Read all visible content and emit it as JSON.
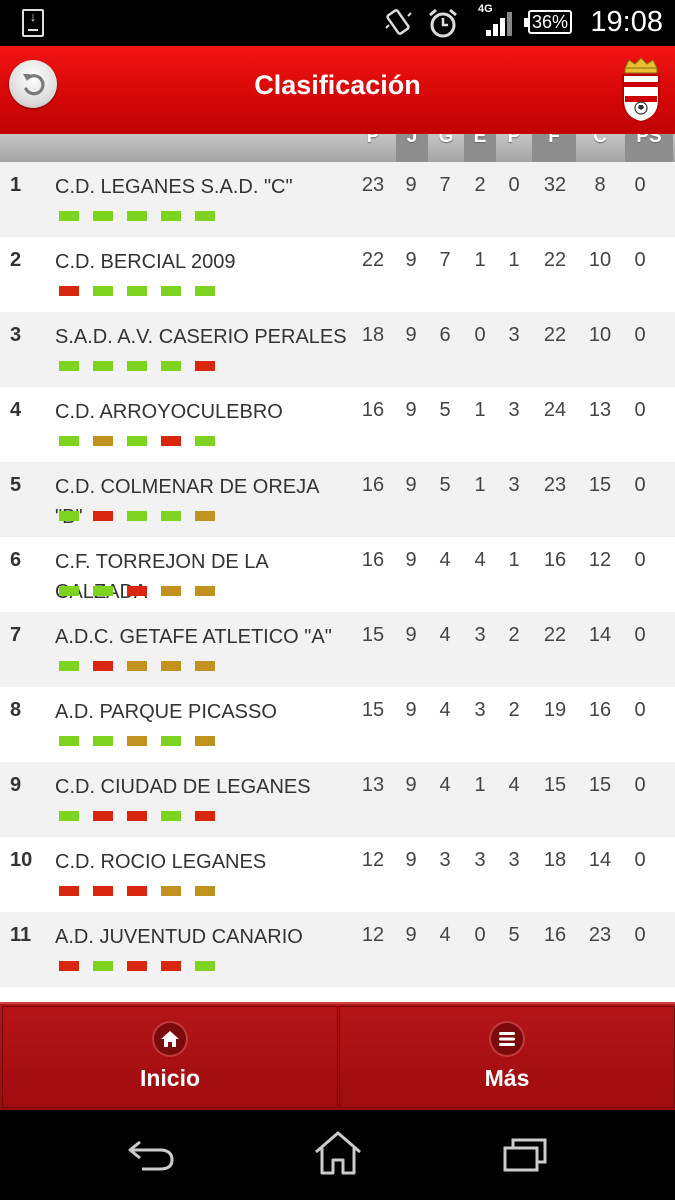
{
  "statusbar": {
    "network": "4G",
    "battery": "36%",
    "time": "19:08"
  },
  "appbar": {
    "title": "Clasificación"
  },
  "colors": {
    "win": "#7ed321",
    "draw": "#c1921f",
    "loss": "#d9260e",
    "brand": "#d40707"
  },
  "columns": [
    "P",
    "J",
    "G",
    "E",
    "P",
    "F",
    "C",
    "PS"
  ],
  "rows": [
    {
      "pos": "1",
      "team": "C.D. LEGANES S.A.D. \"C\"",
      "stats": [
        "23",
        "9",
        "7",
        "2",
        "0",
        "32",
        "8",
        "0"
      ],
      "form": [
        "W",
        "W",
        "W",
        "W",
        "W"
      ]
    },
    {
      "pos": "2",
      "team": "C.D. BERCIAL 2009",
      "stats": [
        "22",
        "9",
        "7",
        "1",
        "1",
        "22",
        "10",
        "0"
      ],
      "form": [
        "L",
        "W",
        "W",
        "W",
        "W"
      ]
    },
    {
      "pos": "3",
      "team": "S.A.D. A.V. CASERIO PERALES",
      "stats": [
        "18",
        "9",
        "6",
        "0",
        "3",
        "22",
        "10",
        "0"
      ],
      "form": [
        "W",
        "W",
        "W",
        "W",
        "L"
      ]
    },
    {
      "pos": "4",
      "team": "C.D. ARROYOCULEBRO",
      "stats": [
        "16",
        "9",
        "5",
        "1",
        "3",
        "24",
        "13",
        "0"
      ],
      "form": [
        "W",
        "D",
        "W",
        "L",
        "W"
      ]
    },
    {
      "pos": "5",
      "team": "C.D. COLMENAR DE OREJA \"B\"",
      "stats": [
        "16",
        "9",
        "5",
        "1",
        "3",
        "23",
        "15",
        "0"
      ],
      "form": [
        "W",
        "L",
        "W",
        "W",
        "D"
      ]
    },
    {
      "pos": "6",
      "team": "C.F. TORREJON DE LA CALZADA",
      "stats": [
        "16",
        "9",
        "4",
        "4",
        "1",
        "16",
        "12",
        "0"
      ],
      "form": [
        "W",
        "W",
        "L",
        "D",
        "D"
      ]
    },
    {
      "pos": "7",
      "team": "A.D.C. GETAFE ATLETICO \"A\"",
      "stats": [
        "15",
        "9",
        "4",
        "3",
        "2",
        "22",
        "14",
        "0"
      ],
      "form": [
        "W",
        "L",
        "D",
        "D",
        "D"
      ]
    },
    {
      "pos": "8",
      "team": "A.D. PARQUE PICASSO",
      "stats": [
        "15",
        "9",
        "4",
        "3",
        "2",
        "19",
        "16",
        "0"
      ],
      "form": [
        "W",
        "W",
        "D",
        "W",
        "D"
      ]
    },
    {
      "pos": "9",
      "team": "C.D. CIUDAD DE LEGANES",
      "stats": [
        "13",
        "9",
        "4",
        "1",
        "4",
        "15",
        "15",
        "0"
      ],
      "form": [
        "W",
        "L",
        "L",
        "W",
        "L"
      ]
    },
    {
      "pos": "10",
      "team": "C.D. ROCIO LEGANES",
      "stats": [
        "12",
        "9",
        "3",
        "3",
        "3",
        "18",
        "14",
        "0"
      ],
      "form": [
        "L",
        "L",
        "L",
        "D",
        "D"
      ]
    },
    {
      "pos": "11",
      "team": "A.D. JUVENTUD CANARIO",
      "stats": [
        "12",
        "9",
        "4",
        "0",
        "5",
        "16",
        "23",
        "0"
      ],
      "form": [
        "L",
        "W",
        "L",
        "L",
        "W"
      ]
    }
  ],
  "bottomnav": {
    "home_label": "Inicio",
    "more_label": "Más"
  },
  "icons": [
    "download-icon",
    "vibrate-icon",
    "alarm-icon",
    "signal-icon",
    "battery-icon",
    "back-arrow-icon",
    "crest-icon",
    "home-icon",
    "menu-icon",
    "android-back-icon",
    "android-home-icon",
    "android-recents-icon"
  ]
}
